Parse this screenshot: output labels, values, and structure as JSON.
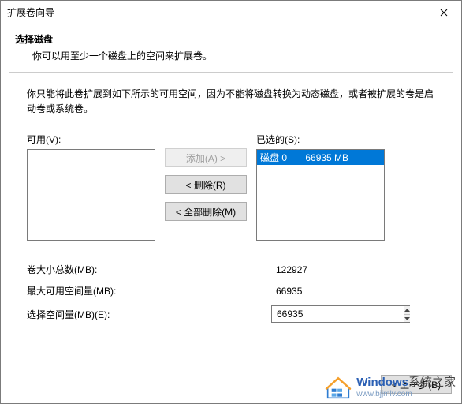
{
  "window": {
    "title": "扩展卷向导"
  },
  "header": {
    "title": "选择磁盘",
    "subtitle": "你可以用至少一个磁盘上的空间来扩展卷。"
  },
  "content": {
    "instruction": "你只能将此卷扩展到如下所示的可用空间，因为不能将磁盘转换为动态磁盘，或者被扩展的卷是启动卷或系统卷。",
    "available_label_prefix": "可用(",
    "available_label_key": "V",
    "available_label_suffix": "):",
    "selected_label_prefix": "已选的(",
    "selected_label_key": "S",
    "selected_label_suffix": "):",
    "selected_items": [
      {
        "text": "磁盘 0       66935 MB"
      }
    ],
    "buttons": {
      "add": "添加(A) >",
      "remove": "< 删除(R)",
      "remove_all": "< 全部删除(M)"
    },
    "fields": {
      "total_label": "卷大小总数(MB):",
      "total_value": "122927",
      "max_label": "最大可用空间量(MB):",
      "max_value": "66935",
      "amount_label": "选择空间量(MB)(E):",
      "amount_value": "66935"
    }
  },
  "footer": {
    "back": "< 上一步(B)"
  },
  "watermark": {
    "brand_html_prefix": "Windows",
    "brand_html_suffix": "系统之家",
    "url": "www.bjjmlv.com"
  }
}
